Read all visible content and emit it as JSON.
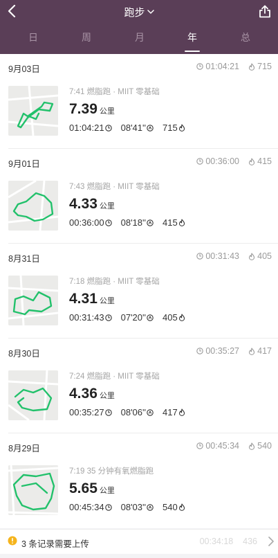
{
  "header": {
    "title": "跑步",
    "tabs": [
      {
        "label": "日",
        "active": false
      },
      {
        "label": "周",
        "active": false
      },
      {
        "label": "月",
        "active": false
      },
      {
        "label": "年",
        "active": true
      },
      {
        "label": "总",
        "active": false
      }
    ]
  },
  "colors": {
    "header_bg": "#5a3e57",
    "route": "#22c16b",
    "tab_inactive": "#a994a6"
  },
  "records": [
    {
      "date": "9月03日",
      "sum_time": "01:04:21",
      "sum_calories": "715",
      "title": "7:41 燃脂跑 · MIIT 零基础",
      "distance": "7.39",
      "unit": "公里",
      "duration": "01:04:21",
      "pace": "08'41''",
      "calories": "715"
    },
    {
      "date": "9月01日",
      "sum_time": "00:36:00",
      "sum_calories": "415",
      "title": "7:43 燃脂跑 · MIIT 零基础",
      "distance": "4.33",
      "unit": "公里",
      "duration": "00:36:00",
      "pace": "08'18''",
      "calories": "415"
    },
    {
      "date": "8月31日",
      "sum_time": "00:31:43",
      "sum_calories": "405",
      "title": "7:18 燃脂跑 · MIIT 零基础",
      "distance": "4.31",
      "unit": "公里",
      "duration": "00:31:43",
      "pace": "07'20''",
      "calories": "405"
    },
    {
      "date": "8月30日",
      "sum_time": "00:35:27",
      "sum_calories": "417",
      "title": "7:24 燃脂跑 · MIIT 零基础",
      "distance": "4.36",
      "unit": "公里",
      "duration": "00:35:27",
      "pace": "08'06''",
      "calories": "417"
    },
    {
      "date": "8月29日",
      "sum_time": "00:45:34",
      "sum_calories": "540",
      "title": "7:19 35 分钟有氧燃脂跑",
      "distance": "5.65",
      "unit": "公里",
      "duration": "00:45:34",
      "pace": "08'03''",
      "calories": "540"
    }
  ],
  "upload": {
    "text": "3 条记录需要上传",
    "ghost_time": "00:34:18",
    "ghost_cal": "436"
  }
}
